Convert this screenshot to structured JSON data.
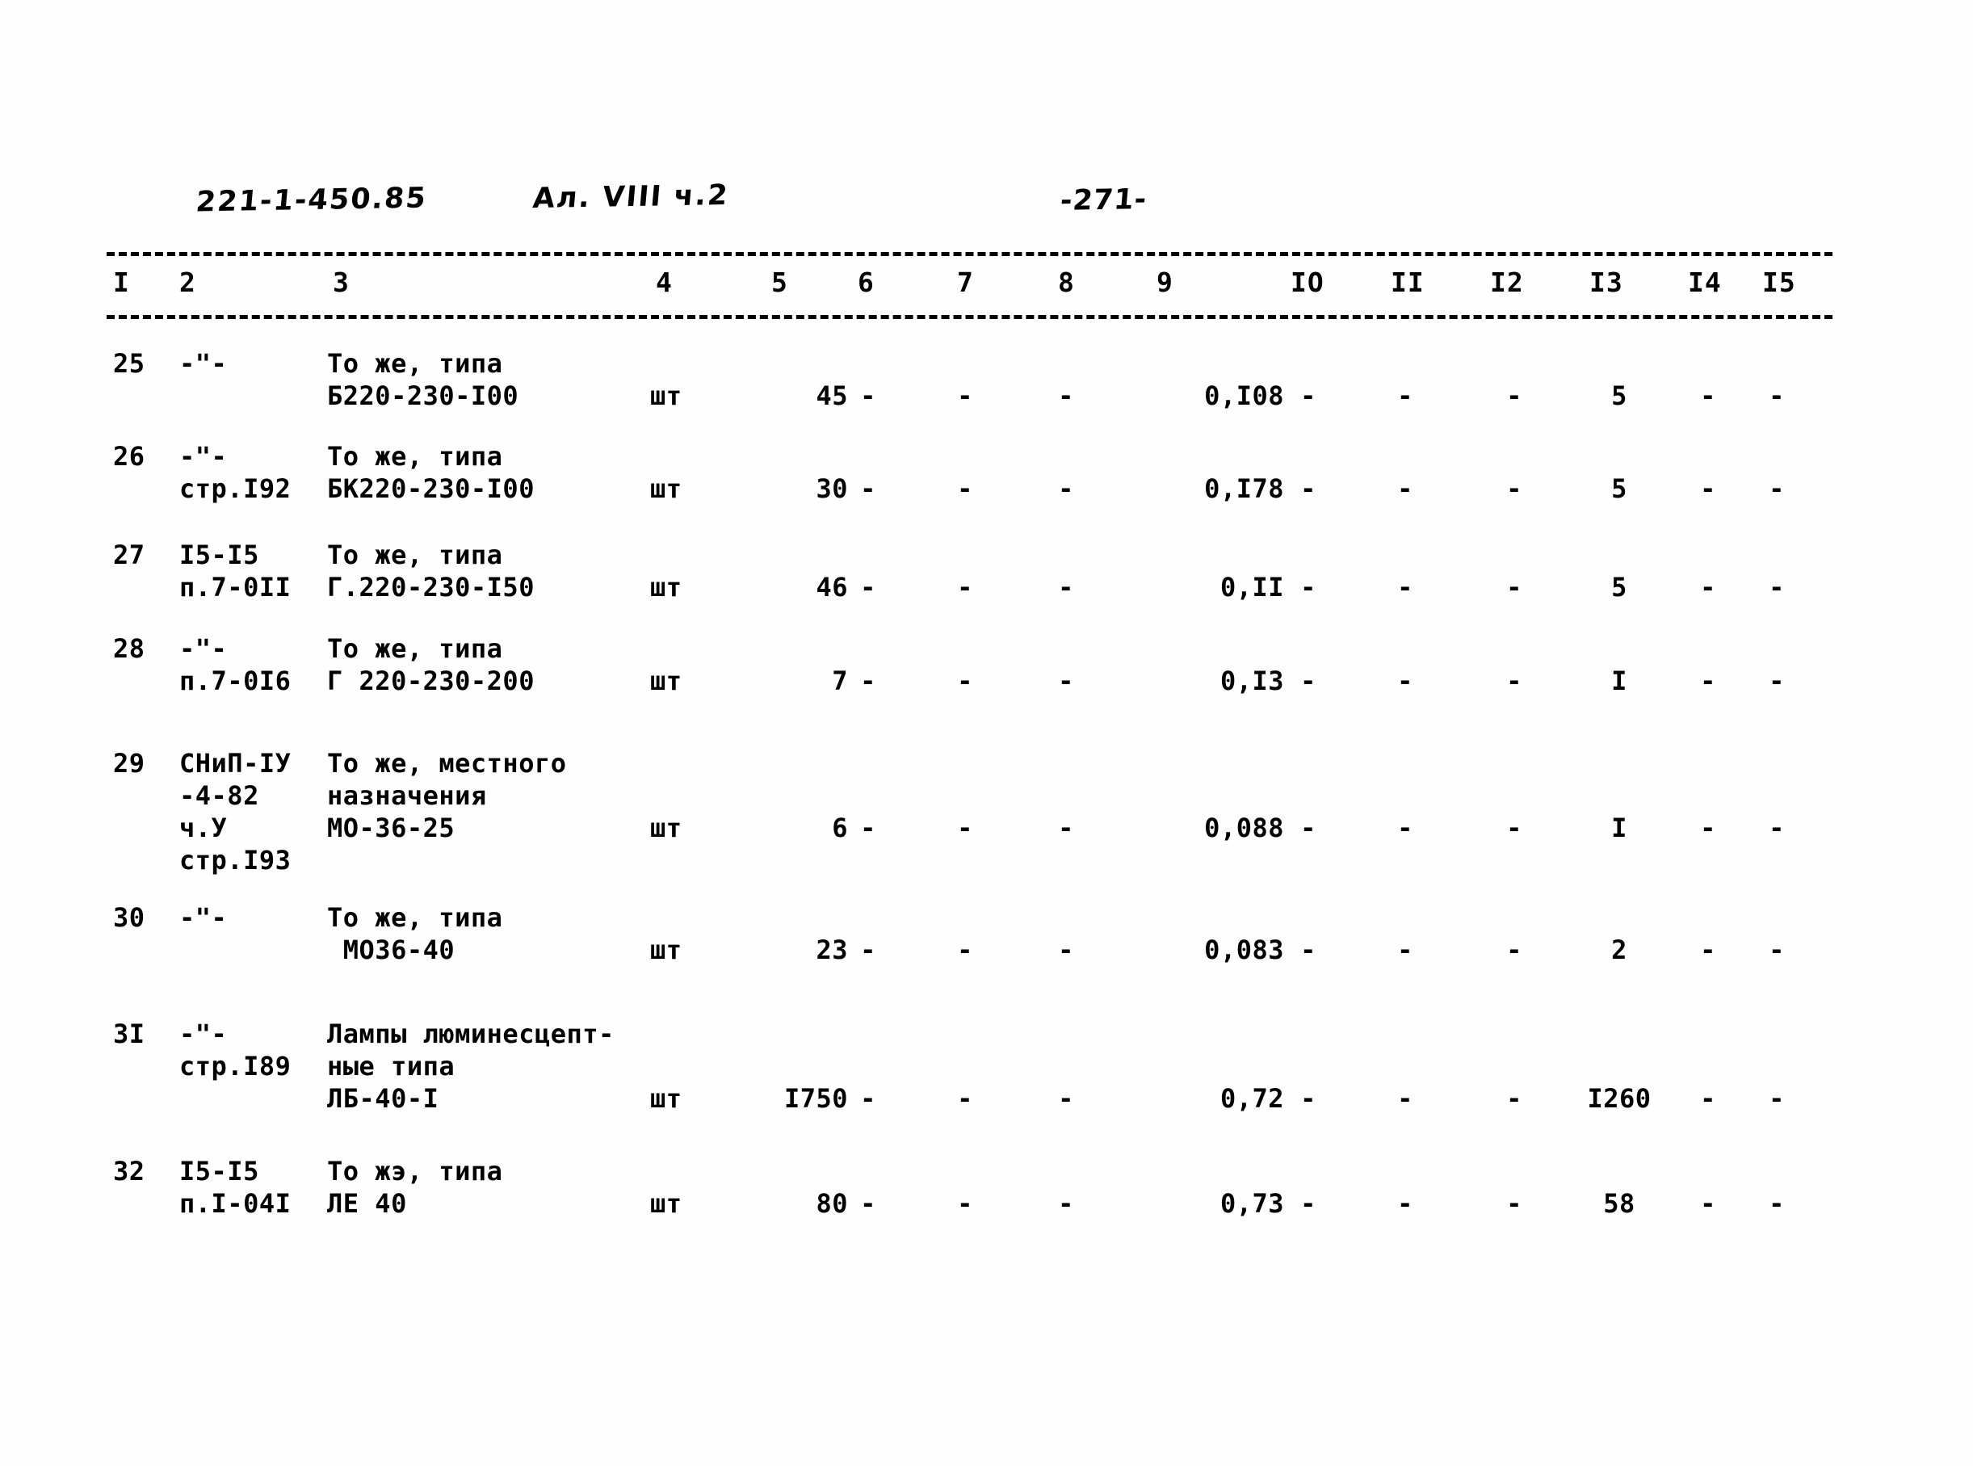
{
  "header": {
    "doc_code": "221-1-450.85",
    "album": "Ал. VIII ч.2",
    "page_number": "-271-"
  },
  "table": {
    "column_headers": [
      "I",
      "2",
      "3",
      "4",
      "5",
      "6",
      "7",
      "8",
      "9",
      "IO",
      "II",
      "I2",
      "I3",
      "I4",
      "I5"
    ],
    "rows": [
      {
        "num": "25",
        "justification": "-\"-",
        "name_line1": "То же, типа",
        "name_line2": "Б220-230-I00",
        "unit": "шт",
        "qty": "45",
        "c6": "-",
        "c7": "-",
        "c8": "-",
        "c9": "0,I08",
        "c10": "-",
        "c11": "-",
        "c12": "-",
        "c13": "5",
        "c14": "-",
        "c15": "-"
      },
      {
        "num": "26",
        "justification": "-\"-",
        "justification_line2": "стр.I92",
        "name_line1": "То же, типа",
        "name_line2": "БК220-230-I00",
        "unit": "шт",
        "qty": "30",
        "c6": "-",
        "c7": "-",
        "c8": "-",
        "c9": "0,I78",
        "c10": "-",
        "c11": "-",
        "c12": "-",
        "c13": "5",
        "c14": "-",
        "c15": "-"
      },
      {
        "num": "27",
        "justification": "I5-I5",
        "justification_line2": "п.7-0II",
        "name_line1": "То же, типа",
        "name_line2": "Г.220-230-I50",
        "unit": "шт",
        "qty": "46",
        "c6": "-",
        "c7": "-",
        "c8": "-",
        "c9": "0,II",
        "c10": "-",
        "c11": "-",
        "c12": "-",
        "c13": "5",
        "c14": "-",
        "c15": "-"
      },
      {
        "num": "28",
        "justification": "-\"-",
        "justification_line2": "п.7-0I6",
        "name_line1": "То же, типа",
        "name_line2": "Г 220-230-200",
        "unit": "шт",
        "qty": "7",
        "c6": "-",
        "c7": "-",
        "c8": "-",
        "c9": "0,I3",
        "c10": "-",
        "c11": "-",
        "c12": "-",
        "c13": "I",
        "c14": "-",
        "c15": "-"
      },
      {
        "num": "29",
        "justification": "СНиП-IУ",
        "justification_line2": "-4-82",
        "justification_line3": "ч.У",
        "justification_line4": "стр.I93",
        "name_line1": "То же, местного",
        "name_line2": "назначения",
        "name_line3": "МО-36-25",
        "unit": "шт",
        "qty": "6",
        "c6": "-",
        "c7": "-",
        "c8": "-",
        "c9": "0,088",
        "c10": "-",
        "c11": "-",
        "c12": "-",
        "c13": "I",
        "c14": "-",
        "c15": "-"
      },
      {
        "num": "30",
        "justification": "-\"-",
        "name_line1": "То же, типа",
        "name_line2": " МО36-40",
        "unit": "шт",
        "qty": "23",
        "c6": "-",
        "c7": "-",
        "c8": "-",
        "c9": "0,083",
        "c10": "-",
        "c11": "-",
        "c12": "-",
        "c13": "2",
        "c14": "-",
        "c15": "-"
      },
      {
        "num": "3I",
        "justification": "-\"-",
        "justification_line2": "стр.I89",
        "name_line1": "Лампы люминесцепт-",
        "name_line2": "ные типа",
        "name_line3": "ЛБ-40-I",
        "unit": "шт",
        "qty": "I750",
        "c6": "-",
        "c7": "-",
        "c8": "-",
        "c9": "0,72",
        "c10": "-",
        "c11": "-",
        "c12": "-",
        "c13": "I260",
        "c14": "-",
        "c15": "-"
      },
      {
        "num": "32",
        "justification": "I5-I5",
        "justification_line2": "п.I-04I",
        "name_line1": "То жэ, типа",
        "name_line2": "ЛЕ 40",
        "unit": "шт",
        "qty": "80",
        "c6": "-",
        "c7": "-",
        "c8": "-",
        "c9": "0,73",
        "c10": "-",
        "c11": "-",
        "c12": "-",
        "c13": "58",
        "c14": "-",
        "c15": "-"
      }
    ]
  }
}
